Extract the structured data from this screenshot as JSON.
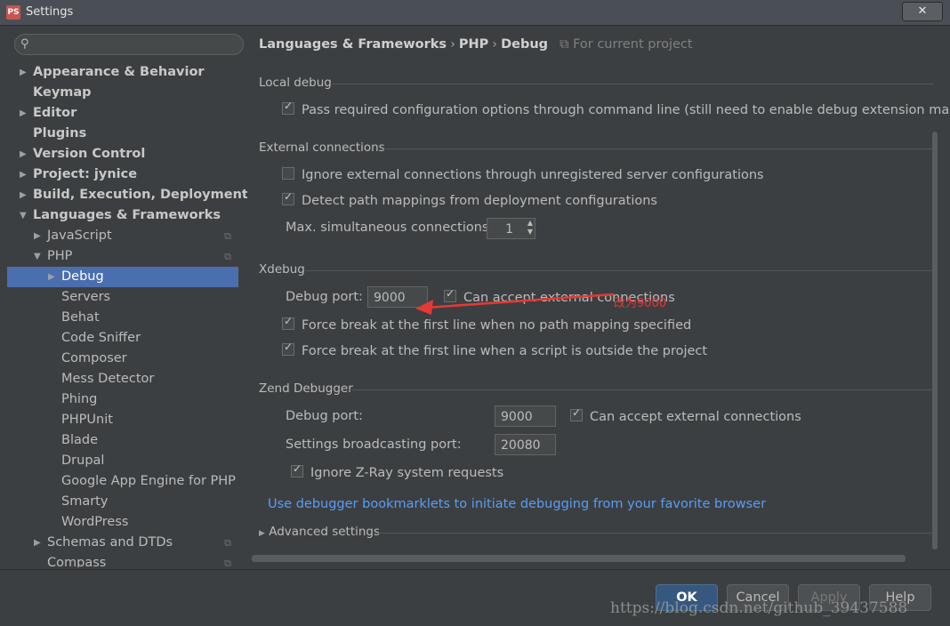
{
  "window": {
    "title": "Settings",
    "close_glyph": "✕"
  },
  "search": {
    "placeholder": ""
  },
  "tree": [
    {
      "label": "Appearance & Behavior",
      "arrow": "▶",
      "bold": true,
      "level": 0
    },
    {
      "label": "Keymap",
      "arrow": "",
      "bold": true,
      "level": 0
    },
    {
      "label": "Editor",
      "arrow": "▶",
      "bold": true,
      "level": 0
    },
    {
      "label": "Plugins",
      "arrow": "",
      "bold": true,
      "level": 0
    },
    {
      "label": "Version Control",
      "arrow": "▶",
      "bold": true,
      "level": 0
    },
    {
      "label": "Project: jynice",
      "arrow": "▶",
      "bold": true,
      "level": 0
    },
    {
      "label": "Build, Execution, Deployment",
      "arrow": "▶",
      "bold": true,
      "level": 0
    },
    {
      "label": "Languages & Frameworks",
      "arrow": "▼",
      "bold": true,
      "level": 0
    },
    {
      "label": "JavaScript",
      "arrow": "▶",
      "bold": false,
      "level": 1,
      "proj": true
    },
    {
      "label": "PHP",
      "arrow": "▼",
      "bold": false,
      "level": 1,
      "proj": true
    },
    {
      "label": "Debug",
      "arrow": "▶",
      "bold": false,
      "level": 2,
      "selected": true
    },
    {
      "label": "Servers",
      "arrow": "",
      "bold": false,
      "level": 2
    },
    {
      "label": "Behat",
      "arrow": "",
      "bold": false,
      "level": 2
    },
    {
      "label": "Code Sniffer",
      "arrow": "",
      "bold": false,
      "level": 2
    },
    {
      "label": "Composer",
      "arrow": "",
      "bold": false,
      "level": 2
    },
    {
      "label": "Mess Detector",
      "arrow": "",
      "bold": false,
      "level": 2
    },
    {
      "label": "Phing",
      "arrow": "",
      "bold": false,
      "level": 2
    },
    {
      "label": "PHPUnit",
      "arrow": "",
      "bold": false,
      "level": 2
    },
    {
      "label": "Blade",
      "arrow": "",
      "bold": false,
      "level": 2
    },
    {
      "label": "Drupal",
      "arrow": "",
      "bold": false,
      "level": 2
    },
    {
      "label": "Google App Engine for PHP",
      "arrow": "",
      "bold": false,
      "level": 2
    },
    {
      "label": "Smarty",
      "arrow": "",
      "bold": false,
      "level": 2
    },
    {
      "label": "WordPress",
      "arrow": "",
      "bold": false,
      "level": 2
    },
    {
      "label": "Schemas and DTDs",
      "arrow": "▶",
      "bold": false,
      "level": 1,
      "proj": true
    },
    {
      "label": "Compass",
      "arrow": "",
      "bold": false,
      "level": 1,
      "proj": true
    }
  ],
  "breadcrumb": {
    "part1": "Languages & Frameworks",
    "part2": "PHP",
    "part3": "Debug",
    "sep": "›",
    "scope": "For current project"
  },
  "local_debug": {
    "title": "Local debug",
    "pass_config": {
      "label": "Pass required configuration options through command line (still need to enable debug extension manual",
      "checked": true
    }
  },
  "external": {
    "title": "External connections",
    "ignore": {
      "label": "Ignore external connections through unregistered server configurations",
      "checked": false
    },
    "detect": {
      "label": "Detect path mappings from deployment configurations",
      "checked": true
    },
    "max_label": "Max. simultaneous connections:",
    "max_value": "1"
  },
  "xdebug": {
    "title": "Xdebug",
    "port_label": "Debug port:",
    "port_value": "9000",
    "accept": {
      "label": "Can accept external connections",
      "checked": true
    },
    "force_no_mapping": {
      "label": "Force break at the first line when no path mapping specified",
      "checked": true
    },
    "force_outside": {
      "label": "Force break at the first line when a script is outside the project",
      "checked": true
    },
    "annotation": "改为9000"
  },
  "zend": {
    "title": "Zend Debugger",
    "port_label": "Debug port:",
    "port_value": "9000",
    "accept": {
      "label": "Can accept external connections",
      "checked": true
    },
    "broadcast_label": "Settings broadcasting port:",
    "broadcast_value": "20080",
    "ignore_zray": {
      "label": "Ignore Z-Ray system requests",
      "checked": true
    }
  },
  "bookmarklets_link": "Use debugger bookmarklets to initiate debugging from your favorite browser",
  "advanced": {
    "label": "Advanced settings",
    "arrow": "▶"
  },
  "buttons": {
    "ok": "OK",
    "cancel": "Cancel",
    "apply": "Apply",
    "help": "Help"
  },
  "watermark": "https://blog.csdn.net/github_39437588",
  "colors": {
    "accent": "#4b6eaf",
    "link": "#589df6",
    "annotation": "#e53935"
  }
}
